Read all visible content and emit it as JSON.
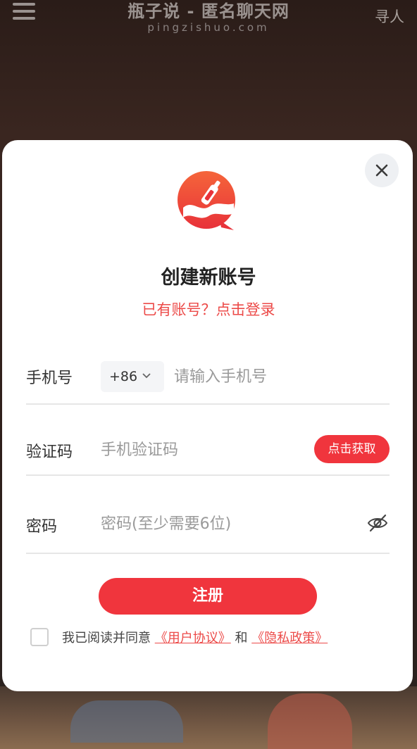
{
  "header": {
    "site_title": "瓶子说 - 匿名聊天网",
    "site_domain": "pingzishuo.com",
    "right_link": "寻人"
  },
  "modal": {
    "title": "创建新账号",
    "login_prompt": "已有账号？点击登录",
    "phone": {
      "label": "手机号",
      "country_code": "+86",
      "placeholder": "请输入手机号"
    },
    "code": {
      "label": "验证码",
      "placeholder": "手机验证码",
      "button": "点击获取"
    },
    "password": {
      "label": "密码",
      "placeholder": "密码(至少需要6位)"
    },
    "register_button": "注册",
    "agreement": {
      "prefix": "我已阅读并同意",
      "user_agreement": "《用户协议》",
      "conjunction": "和",
      "privacy_policy": "《隐私政策》"
    }
  },
  "colors": {
    "accent": "#f0353d",
    "link": "#ec4a48"
  }
}
